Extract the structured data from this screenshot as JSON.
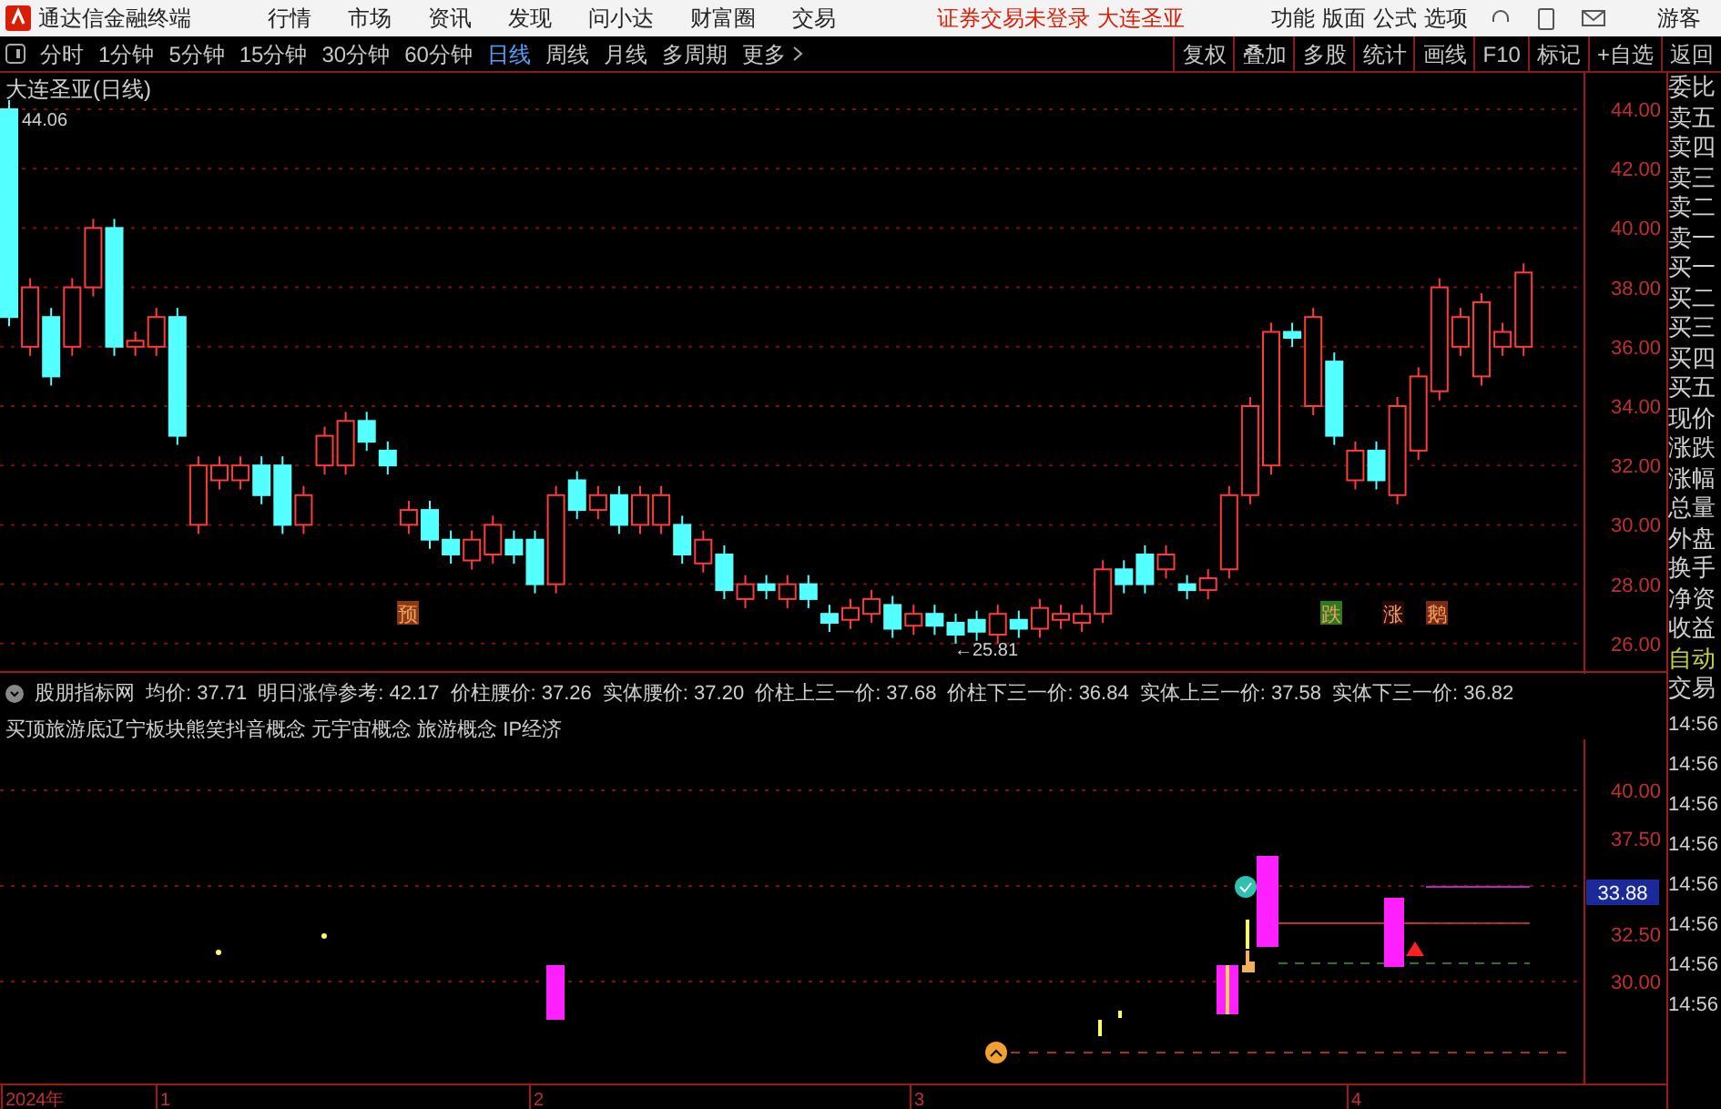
{
  "title_bar": {
    "app_name": "通达信金融终端",
    "menus": [
      "行情",
      "市场",
      "资讯",
      "发现",
      "问小达",
      "财富圈",
      "交易"
    ],
    "status": [
      "证券交易未登录",
      "大连圣亚"
    ],
    "right_menus": [
      "功能",
      "版面",
      "公式",
      "选项"
    ],
    "user": "游客"
  },
  "period_tabs": [
    {
      "label": "分时",
      "selected": false
    },
    {
      "label": "1分钟",
      "selected": false
    },
    {
      "label": "5分钟",
      "selected": false
    },
    {
      "label": "15分钟",
      "selected": false
    },
    {
      "label": "30分钟",
      "selected": false
    },
    {
      "label": "60分钟",
      "selected": false
    },
    {
      "label": "日线",
      "selected": true
    },
    {
      "label": "周线",
      "selected": false
    },
    {
      "label": "月线",
      "selected": false
    },
    {
      "label": "多周期",
      "selected": false
    },
    {
      "label": "更多",
      "selected": false
    }
  ],
  "toolbar_buttons": [
    "复权",
    "叠加",
    "多股",
    "统计",
    "画线",
    "F10",
    "标记",
    "+自选",
    "返回"
  ],
  "main_chart": {
    "title": "大连圣亚(日线)",
    "high_label": "44.06",
    "low_label": "←25.81",
    "price_axis": [
      "44.00",
      "42.00",
      "40.00",
      "38.00",
      "36.00",
      "34.00",
      "32.00",
      "30.00",
      "28.00",
      "26.00"
    ],
    "signals": [
      {
        "text": "预",
        "color": "#8a3a10"
      },
      {
        "text": "跌",
        "color": "#2f7a1f"
      },
      {
        "text": "涨",
        "color": "#2a0808"
      },
      {
        "text": "鹅",
        "color": "#7a2a10"
      }
    ]
  },
  "indicator": {
    "name": "股朋指标网",
    "values": [
      "均价: 37.71",
      "明日涨停参考: 42.17",
      "价柱腰价: 37.26",
      "实体腰价: 37.20",
      "价柱上三一价: 37.68",
      "价柱下三一价: 36.84",
      "实体上三一价: 37.58",
      "实体下三一价: 36.82"
    ],
    "concepts": "买顶旅游底辽宁板块熊笑抖音概念 元宇宙概念 旅游概念 IP经济",
    "axis": [
      "40.00",
      "37.50",
      "32.50",
      "30.00"
    ],
    "current_value": "33.88"
  },
  "time_axis": [
    "2024年",
    "1",
    "2",
    "3",
    "4"
  ],
  "quote_panel": [
    {
      "label": "委比",
      "highlight": false
    },
    {
      "label": "卖五",
      "highlight": false
    },
    {
      "label": "卖四",
      "highlight": false
    },
    {
      "label": "卖三",
      "highlight": false
    },
    {
      "label": "卖二",
      "highlight": false
    },
    {
      "label": "卖一",
      "highlight": false
    },
    {
      "label": "买一",
      "highlight": false
    },
    {
      "label": "买二",
      "highlight": false
    },
    {
      "label": "买三",
      "highlight": false
    },
    {
      "label": "买四",
      "highlight": false
    },
    {
      "label": "买五",
      "highlight": false
    },
    {
      "label": "现价",
      "highlight": false
    },
    {
      "label": "涨跌",
      "highlight": false
    },
    {
      "label": "涨幅",
      "highlight": false
    },
    {
      "label": "总量",
      "highlight": false
    },
    {
      "label": "外盘",
      "highlight": false
    },
    {
      "label": "换手",
      "highlight": false
    },
    {
      "label": "净资",
      "highlight": false
    },
    {
      "label": "收益",
      "highlight": false
    },
    {
      "label": "自动",
      "highlight": true
    },
    {
      "label": "交易",
      "highlight": false
    }
  ],
  "trade_times": [
    "14:56",
    "14:56",
    "14:56",
    "14:56",
    "14:56",
    "14:56",
    "14:56",
    "14:56"
  ]
}
